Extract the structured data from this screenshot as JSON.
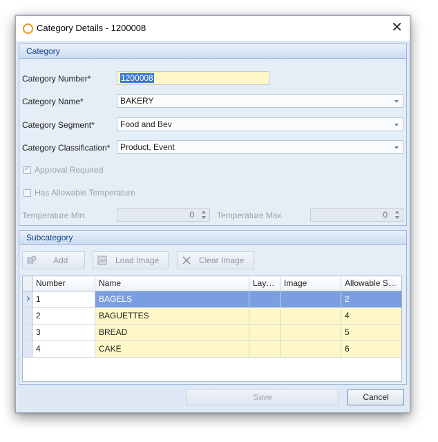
{
  "window": {
    "title": "Category Details - 1200008",
    "close_glyph": "✕"
  },
  "category_panel": {
    "header": "Category",
    "number_label": "Category Number*",
    "number_value": "1200008",
    "name_label": "Category Name*",
    "name_value": "BAKERY",
    "segment_label": "Category Segment*",
    "segment_value": "Food and Bev",
    "classification_label": "Category Classification*",
    "classification_value": "Product, Event",
    "approval_label": "Approval Required",
    "allowable_temp_label": "Has Allowable Temperature",
    "temp_min_label": "Temperature Min.",
    "temp_min_value": "0",
    "temp_max_label": "Temperature Max.",
    "temp_max_value": "0"
  },
  "subcategory_panel": {
    "header": "Subcategory",
    "add_label": "Add",
    "load_image_label": "Load Image",
    "clear_image_label": "Clear Image",
    "columns": [
      "Number",
      "Name",
      "Lay…",
      "Image",
      "Allowable S…"
    ],
    "rows": [
      {
        "number": "1",
        "name": "BAGELS",
        "lay": "",
        "image": "",
        "allowable": "2"
      },
      {
        "number": "2",
        "name": "BAGUETTES",
        "lay": "",
        "image": "",
        "allowable": "4"
      },
      {
        "number": "3",
        "name": "BREAD",
        "lay": "",
        "image": "",
        "allowable": "5"
      },
      {
        "number": "4",
        "name": "CAKE",
        "lay": "",
        "image": "",
        "allowable": "6"
      }
    ]
  },
  "footer": {
    "save_label": "Save",
    "cancel_label": "Cancel"
  },
  "colors": {
    "accent": "#f0961e",
    "selection": "#3b78d6",
    "row_highlight": "#fef7c7",
    "selected_row": "#7b9ee0"
  }
}
